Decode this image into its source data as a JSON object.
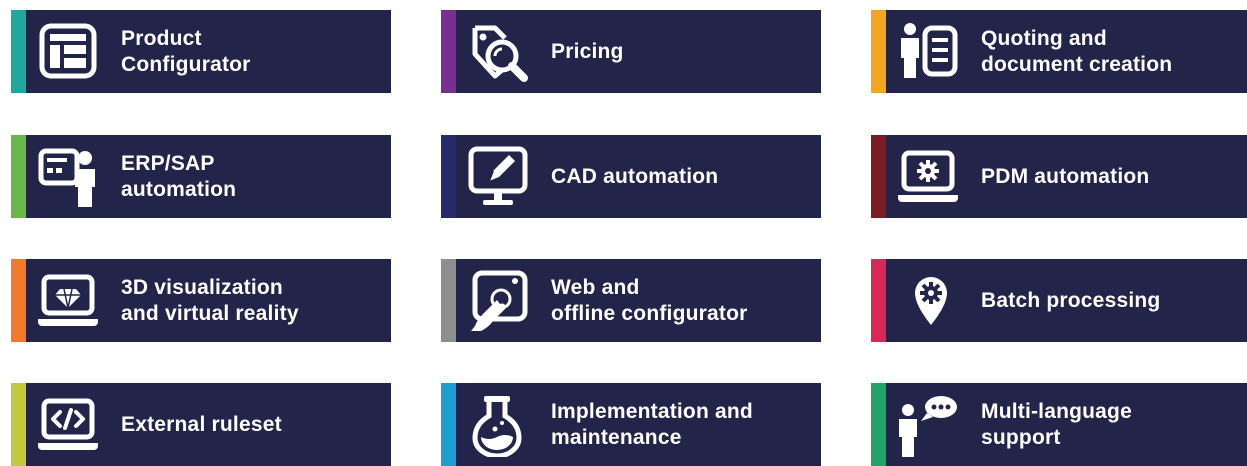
{
  "tiles": [
    {
      "id": "product-configurator",
      "lines": [
        "Product",
        "Configurator"
      ],
      "accent": "#1fa99d",
      "icon": "configurator-window-icon"
    },
    {
      "id": "pricing",
      "lines": [
        "Pricing",
        ""
      ],
      "accent": "#7a2e90",
      "icon": "price-tag-search-icon"
    },
    {
      "id": "quoting",
      "lines": [
        "Quoting and",
        "document creation"
      ],
      "accent": "#f3a521",
      "icon": "person-document-icon"
    },
    {
      "id": "erp-sap",
      "lines": [
        "ERP/SAP",
        "automation"
      ],
      "accent": "#6bb84a",
      "icon": "presenter-screen-icon"
    },
    {
      "id": "cad",
      "lines": [
        "CAD automation",
        ""
      ],
      "accent": "#262a6b",
      "icon": "monitor-pen-icon"
    },
    {
      "id": "pdm",
      "lines": [
        "PDM automation",
        ""
      ],
      "accent": "#7a1c25",
      "icon": "laptop-gear-icon"
    },
    {
      "id": "3d",
      "lines": [
        "3D visualization",
        "and virtual reality"
      ],
      "accent": "#f37a2a",
      "icon": "laptop-diamond-icon"
    },
    {
      "id": "web",
      "lines": [
        "Web and",
        "offline configurator"
      ],
      "accent": "#8e8e8e",
      "icon": "touch-screen-icon"
    },
    {
      "id": "batch",
      "lines": [
        "Batch processing",
        ""
      ],
      "accent": "#d8285a",
      "icon": "location-gear-icon"
    },
    {
      "id": "external",
      "lines": [
        "External ruleset",
        ""
      ],
      "accent": "#c2c93a",
      "icon": "code-laptop-icon"
    },
    {
      "id": "implementation",
      "lines": [
        "Implementation and",
        "maintenance"
      ],
      "accent": "#1d9fd6",
      "icon": "flask-icon"
    },
    {
      "id": "multilang",
      "lines": [
        "Multi-language",
        "support"
      ],
      "accent": "#22a36a",
      "icon": "person-speech-icon"
    }
  ]
}
